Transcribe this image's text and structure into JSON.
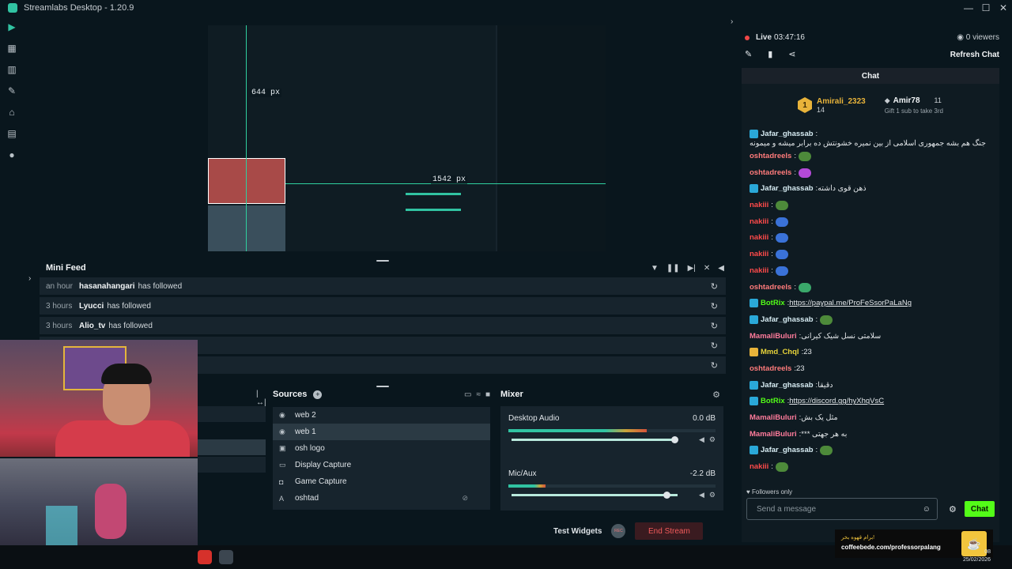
{
  "window": {
    "title": "Streamlabs Desktop - 1.20.9",
    "controls": [
      "—",
      "☐",
      "✕"
    ]
  },
  "preview": {
    "guide_h_label": "644 px",
    "guide_v_label": "1542 px"
  },
  "mini_feed": {
    "title": "Mini Feed",
    "rows": [
      {
        "time": "an hour",
        "user": "hasanahangari",
        "action": "has followed"
      },
      {
        "time": "3 hours",
        "user": "Lyucci",
        "action": "has followed"
      },
      {
        "time": "3 hours",
        "user": "Alio_tv",
        "action": "has followed"
      },
      {
        "time": "",
        "user": "",
        "action": ""
      },
      {
        "time": "",
        "user": "",
        "action": ""
      }
    ]
  },
  "sources": {
    "title": "Sources",
    "items": [
      {
        "icon": "webcam-icon",
        "label": "web 2",
        "selected": false
      },
      {
        "icon": "webcam-icon",
        "label": "web 1",
        "selected": true
      },
      {
        "icon": "image-icon",
        "label": "osh logo",
        "selected": false
      },
      {
        "icon": "monitor-icon",
        "label": "Display Capture",
        "selected": false
      },
      {
        "icon": "gamepad-icon",
        "label": "Game Capture",
        "selected": false
      },
      {
        "icon": "text-icon",
        "label": "oshtad",
        "selected": false,
        "hidden": true
      }
    ]
  },
  "mixer": {
    "title": "Mixer",
    "channels": [
      {
        "name": "Desktop Audio",
        "db": "0.0 dB",
        "level": 0.82,
        "volume": 1.0
      },
      {
        "name": "Mic/Aux",
        "db": "-2.2 dB",
        "level": 0.22,
        "volume": 0.95
      }
    ]
  },
  "footer": {
    "test_widgets": "Test Widgets",
    "rec_label": "REC",
    "end_stream": "End Stream"
  },
  "stream": {
    "live_label": "Live",
    "live_time": "03:47:16",
    "viewers": "0 viewers",
    "refresh_chat": "Refresh Chat"
  },
  "chat": {
    "title": "Chat",
    "banner": {
      "user1": "Amirali_2323",
      "user1_count": "14",
      "user1_rank": "1",
      "user2": "Amir78",
      "user2_count": "11",
      "gift_text": "Gift 1 sub to take 3rd"
    },
    "messages": [
      {
        "user": "Jafar_ghassab",
        "color": "#d7ecf3",
        "badge": "#2aa8d8",
        "text": "جنگ هم بشه جمهوری اسلامی از بین نمیره خشونتش ده برابر میشه و میمونه",
        "emote": ""
      },
      {
        "user": "oshtadreels",
        "color": "#ff7b7b",
        "badge": "",
        "text": "",
        "emote": "#4d8a3a"
      },
      {
        "user": "oshtadreels",
        "color": "#ff7b7b",
        "badge": "",
        "text": "",
        "emote": "#b44ad8"
      },
      {
        "user": "Jafar_ghassab",
        "color": "#d7ecf3",
        "badge": "#2aa8d8",
        "text": "ذهن قوی داشته",
        "emote": ""
      },
      {
        "user": "nakiii",
        "color": "#ff4a4a",
        "badge": "",
        "text": "",
        "emote": "#4d8a3a"
      },
      {
        "user": "nakiii",
        "color": "#ff4a4a",
        "badge": "",
        "text": "",
        "emote": "#3a72d8"
      },
      {
        "user": "nakiii",
        "color": "#ff4a4a",
        "badge": "",
        "text": "",
        "emote": "#3a72d8"
      },
      {
        "user": "nakiii",
        "color": "#ff4a4a",
        "badge": "",
        "text": "",
        "emote": "#3a72d8"
      },
      {
        "user": "nakiii",
        "color": "#ff4a4a",
        "badge": "",
        "text": "",
        "emote": "#3a72d8"
      },
      {
        "user": "oshtadreels",
        "color": "#ff7b7b",
        "badge": "",
        "text": "",
        "emote": "#3aa86a"
      },
      {
        "user": "BotRix",
        "color": "#53fc18",
        "badge": "#2aa8d8",
        "text": "",
        "link": "https://paypal.me/ProFeSsorPaLaNg",
        "emote": ""
      },
      {
        "user": "Jafar_ghassab",
        "color": "#d7ecf3",
        "badge": "#2aa8d8",
        "text": "",
        "emote": "#4d8a3a"
      },
      {
        "user": "MamaliBuluri",
        "color": "#ff7b9b",
        "badge": "",
        "text": "سلامتی نسل شیک کیرانی",
        "emote": ""
      },
      {
        "user": "Mmd_Chql",
        "color": "#e8d43a",
        "badge": "#e8b33a",
        "text": "23",
        "emote": ""
      },
      {
        "user": "oshtadreels",
        "color": "#ff7b7b",
        "badge": "",
        "text": "23",
        "emote": ""
      },
      {
        "user": "Jafar_ghassab",
        "color": "#d7ecf3",
        "badge": "#2aa8d8",
        "text": "دقیقا",
        "emote": ""
      },
      {
        "user": "BotRix",
        "color": "#53fc18",
        "badge": "#2aa8d8",
        "text": "",
        "link": "https://discord.gg/hyXhqVsC",
        "emote": ""
      },
      {
        "user": "MamaliBuluri",
        "color": "#ff7b9b",
        "badge": "",
        "text": "مثل یک بش",
        "emote": ""
      },
      {
        "user": "MamaliBuluri",
        "color": "#ff7b9b",
        "badge": "",
        "text": "*** به هر جهتی",
        "emote": ""
      },
      {
        "user": "Jafar_ghassab",
        "color": "#d7ecf3",
        "badge": "#2aa8d8",
        "text": "",
        "emote": "#4d8a3a"
      },
      {
        "user": "nakiii",
        "color": "#ff4a4a",
        "badge": "",
        "text": "",
        "emote": "#4d8a3a"
      }
    ],
    "followers_only": "Followers only",
    "input_placeholder": "Send a message",
    "send_label": "Chat"
  },
  "overlay": {
    "coffee_text": "برام قهوه بخر!",
    "coffee_url": "coffeebede.com/professorpalang"
  },
  "clock": {
    "time": "08",
    "date": "25/02/2026"
  }
}
